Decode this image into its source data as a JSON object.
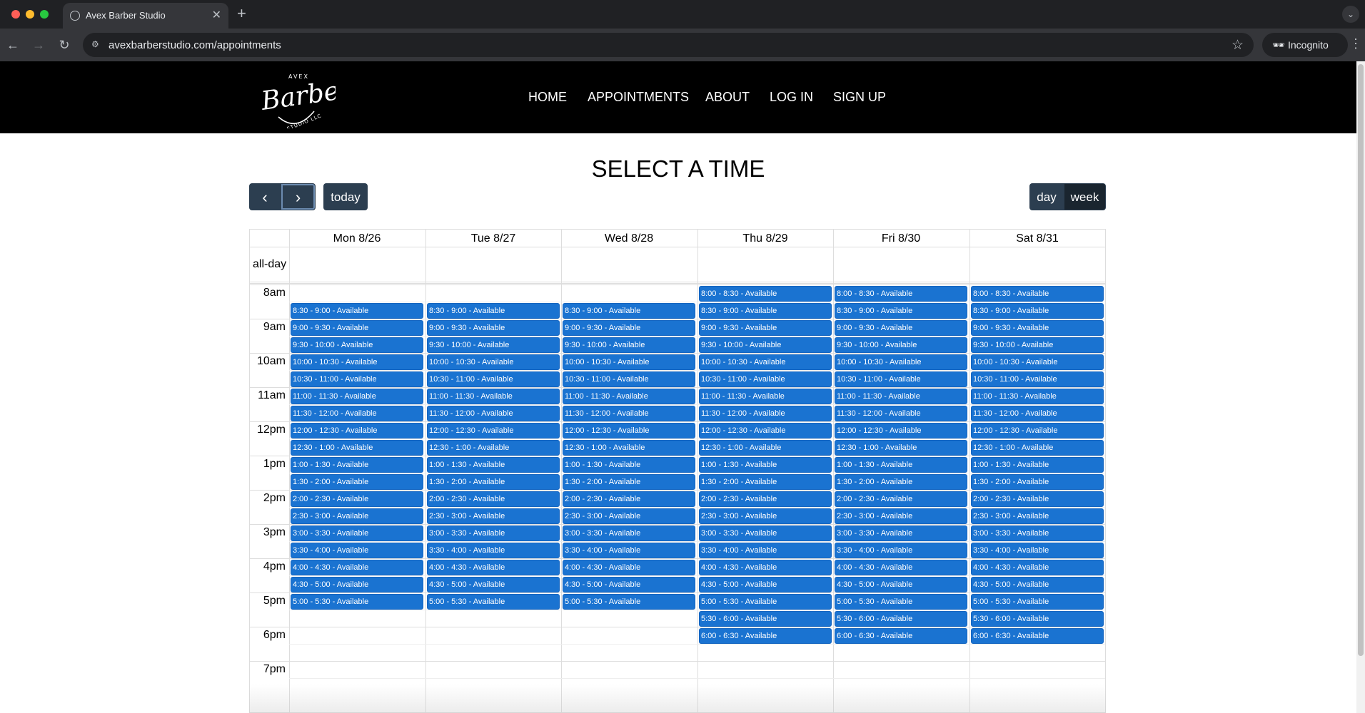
{
  "browser": {
    "tab_title": "Avex Barber Studio",
    "url": "avexbarberstudio.com/appointments",
    "incognito_label": "Incognito"
  },
  "site": {
    "logo_top": "AVEX",
    "logo_main": "Barber",
    "logo_bottom": "STUDIO LLC",
    "nav": [
      "HOME",
      "APPOINTMENTS",
      "ABOUT",
      "LOG IN",
      "SIGN UP"
    ]
  },
  "page": {
    "title": "SELECT A TIME"
  },
  "calendar": {
    "today_label": "today",
    "day_label": "day",
    "week_label": "week",
    "allday_label": "all-day",
    "days": [
      "Mon 8/26",
      "Tue 8/27",
      "Wed 8/28",
      "Thu 8/29",
      "Fri 8/30",
      "Sat 8/31"
    ],
    "hours": [
      "8am",
      "9am",
      "10am",
      "11am",
      "12pm",
      "1pm",
      "2pm",
      "3pm",
      "4pm",
      "5pm",
      "6pm",
      "7pm"
    ],
    "slot_status": "Available",
    "slots": [
      "8:00 - 8:30",
      "8:30 - 9:00",
      "9:00 - 9:30",
      "9:30 - 10:00",
      "10:00 - 10:30",
      "10:30 - 11:00",
      "11:00 - 11:30",
      "11:30 - 12:00",
      "12:00 - 12:30",
      "12:30 - 1:00",
      "1:00 - 1:30",
      "1:30 - 2:00",
      "2:00 - 2:30",
      "2:30 - 3:00",
      "3:00 - 3:30",
      "3:30 - 4:00",
      "4:00 - 4:30",
      "4:30 - 5:00",
      "5:00 - 5:30",
      "5:30 - 6:00",
      "6:00 - 6:30"
    ],
    "day_slot_ranges": [
      {
        "first": 1,
        "last": 18
      },
      {
        "first": 1,
        "last": 18
      },
      {
        "first": 1,
        "last": 18
      },
      {
        "first": 0,
        "last": 20
      },
      {
        "first": 0,
        "last": 20
      },
      {
        "first": 0,
        "last": 20
      }
    ]
  },
  "colors": {
    "slot_bg": "#1a73d1",
    "button_bg": "#2c3e50",
    "header_bg": "#000000"
  }
}
